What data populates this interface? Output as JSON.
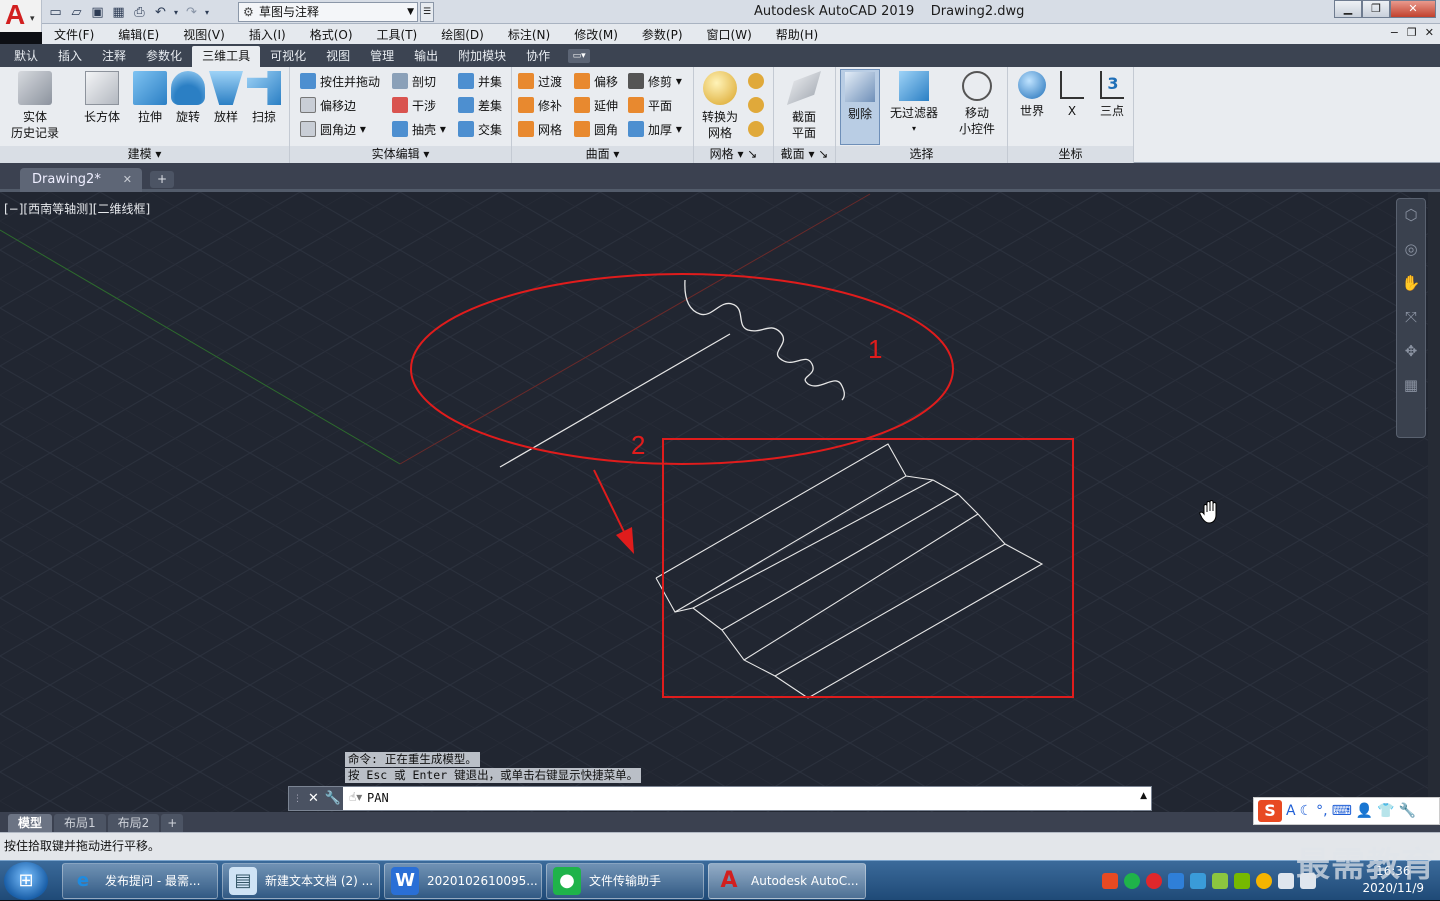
{
  "app": {
    "title": "Autodesk AutoCAD 2019",
    "file": "Drawing2.dwg",
    "workspace": "草图与注释",
    "logo_letter": "A"
  },
  "menu": [
    "文件(F)",
    "编辑(E)",
    "视图(V)",
    "插入(I)",
    "格式(O)",
    "工具(T)",
    "绘图(D)",
    "标注(N)",
    "修改(M)",
    "参数(P)",
    "窗口(W)",
    "帮助(H)"
  ],
  "ribbon_tabs": [
    "默认",
    "插入",
    "注释",
    "参数化",
    "三维工具",
    "可视化",
    "视图",
    "管理",
    "输出",
    "附加模块",
    "协作"
  ],
  "ribbon": {
    "modeling": {
      "title": "建模",
      "history": [
        "实体",
        "历史记录"
      ],
      "box": "长方体",
      "extrude": "拉伸",
      "revolve": "旋转",
      "loft": "放样",
      "sweep": "扫掠"
    },
    "solid_edit": {
      "title": "实体编辑",
      "items": [
        "按住并拖动",
        "剖切",
        "并集",
        "偏移边",
        "干涉",
        "差集",
        "圆角边",
        "抽壳",
        "交集"
      ]
    },
    "surface": {
      "title": "曲面",
      "items": [
        "过渡",
        "偏移",
        "修剪",
        "修补",
        "延伸",
        "平面",
        "网格",
        "圆角",
        "加厚"
      ]
    },
    "mesh": {
      "title": "网格",
      "convert": [
        "转换为",
        "网格"
      ]
    },
    "section": {
      "title": "截面",
      "plane": [
        "截面",
        "平面"
      ]
    },
    "selection": {
      "title": "选择",
      "cull": "剔除",
      "nofilter": "无过滤器",
      "gizmo": [
        "移动",
        "小控件"
      ]
    },
    "coords": {
      "title": "坐标",
      "world": "世界",
      "x": "X",
      "three": "三点"
    }
  },
  "doc_tab": "Drawing2*",
  "viewport": {
    "label": "[−][西南等轴测][二维线框]",
    "annotation_1": "1",
    "annotation_2": "2",
    "colors": {
      "background": "#212631",
      "grid": "#2b313d",
      "annot": "#e01c1c",
      "lines": "#e6e6e6"
    }
  },
  "command": {
    "history": [
      "命令: 正在重生成模型。",
      "按 Esc 或 Enter 键退出，或单击右键显示快捷菜单。"
    ],
    "current": "PAN"
  },
  "layout_tabs": [
    "模型",
    "布局1",
    "布局2"
  ],
  "status_text": "按住拾取键并拖动进行平移。",
  "taskbar": {
    "items": [
      "发布提问 - 最需...",
      "新建文本文档 (2) ...",
      "2020102610095...",
      "文件传输助手",
      "Autodesk AutoC..."
    ],
    "time": "16:36",
    "date": "2020/11/9"
  },
  "watermark": "最需教育"
}
